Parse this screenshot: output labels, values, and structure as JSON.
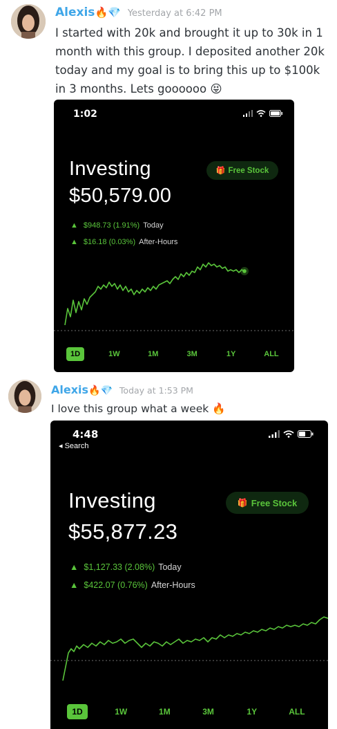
{
  "messages": [
    {
      "username": "Alexis",
      "badges": [
        "🔥",
        "💎"
      ],
      "timestamp": "Yesterday at 6:42 PM",
      "text": "I started with 20k and brought it up to 30k in 1 month with this group. I deposited another 20k today and my goal is to bring this up to $100k in 3 months. Lets goooooo 😝",
      "screenshot": {
        "clock": "1:02",
        "title": "Investing",
        "balance": "$50,579.00",
        "free_stock": "Free Stock",
        "today_change": "$948.73 (1.91%)",
        "today_label": "Today",
        "after_change": "$16.18 (0.03%)",
        "after_label": "After-Hours",
        "ranges": [
          "1D",
          "1W",
          "1M",
          "3M",
          "1Y",
          "ALL"
        ],
        "selected_range": "1D",
        "accent": "#5ac53b"
      }
    },
    {
      "username": "Alexis",
      "badges": [
        "🔥",
        "💎"
      ],
      "timestamp": "Today at 1:53 PM",
      "text": "I love this group what a week 🔥",
      "screenshot": {
        "clock": "4:48",
        "back_label": "◂ Search",
        "title": "Investing",
        "balance": "$55,877.23",
        "free_stock": "Free Stock",
        "today_change": "$1,127.33 (2.08%)",
        "today_label": "Today",
        "after_change": "$422.07 (0.76%)",
        "after_label": "After-Hours",
        "ranges": [
          "1D",
          "1W",
          "1M",
          "3M",
          "1Y",
          "ALL"
        ],
        "selected_range": "1D",
        "accent": "#5ac53b"
      }
    }
  ]
}
